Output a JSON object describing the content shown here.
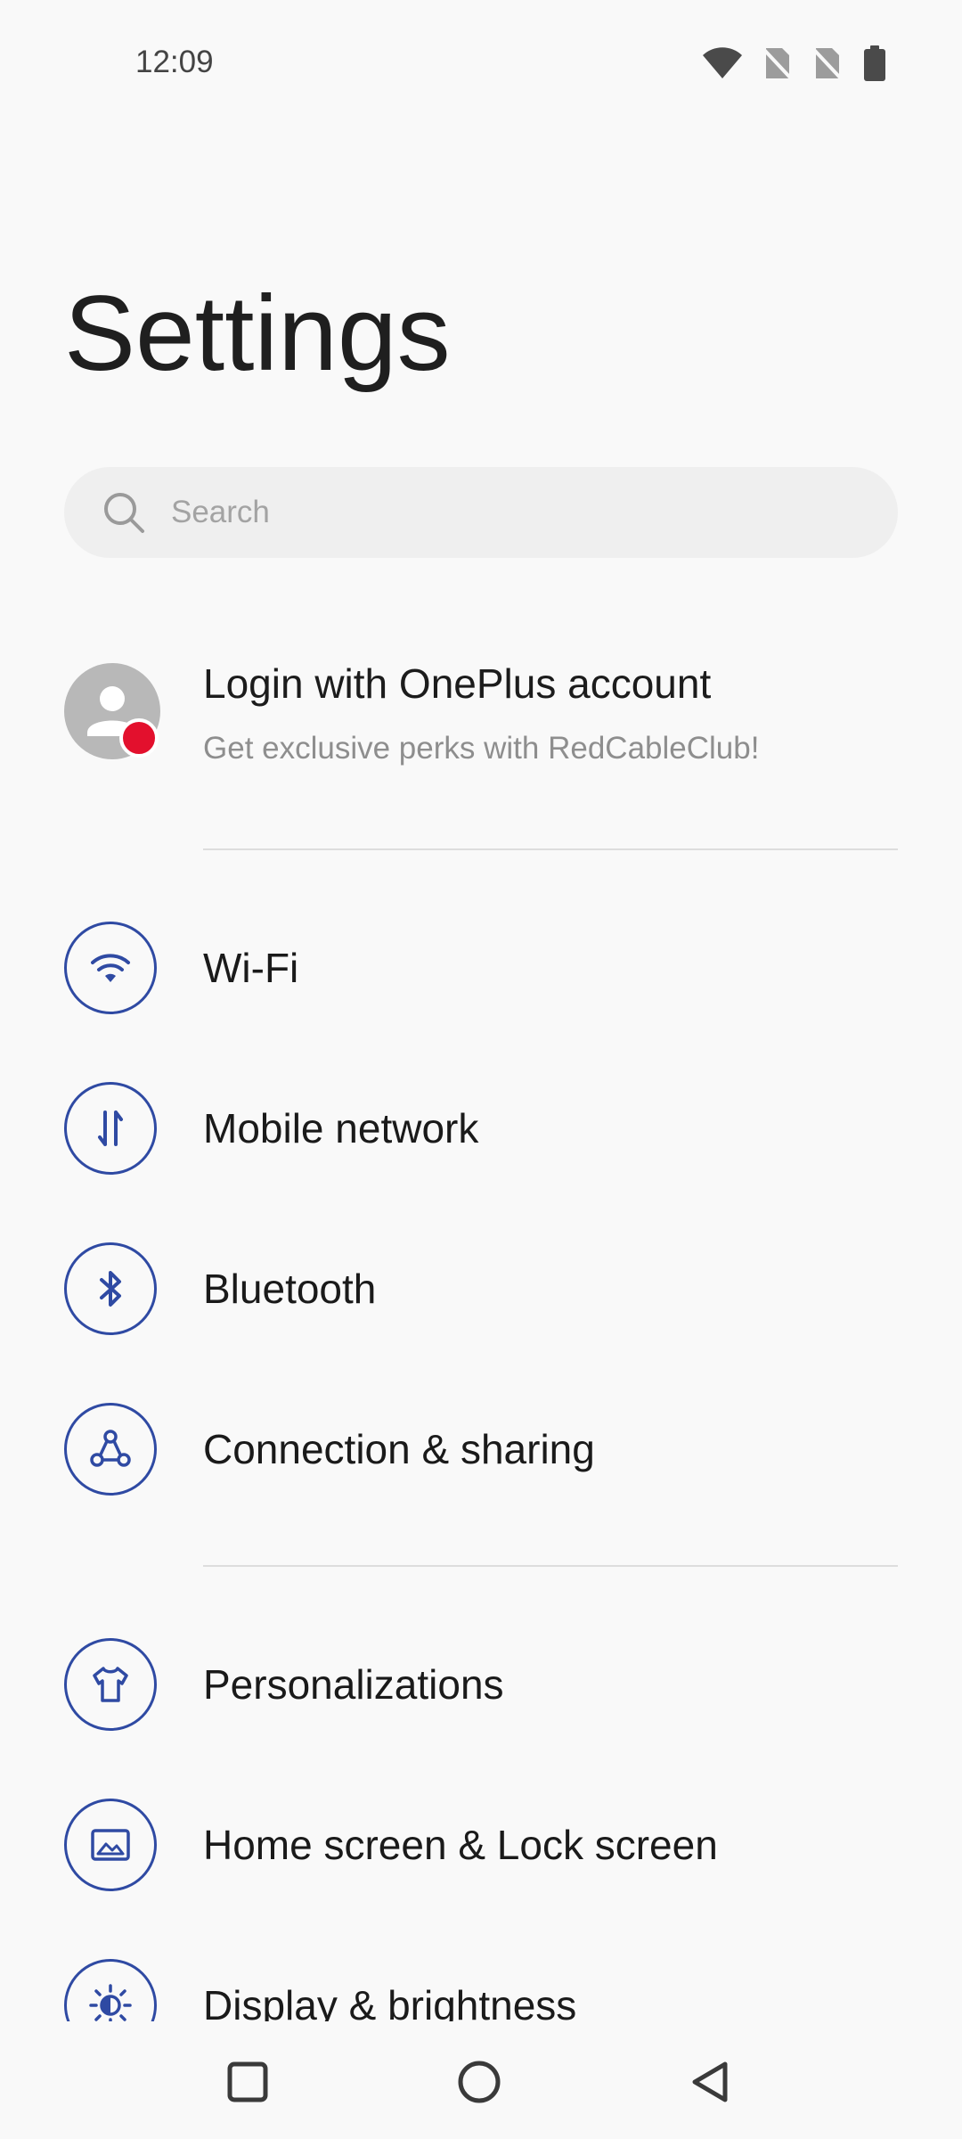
{
  "status_bar": {
    "time": "12:09",
    "icons": [
      "wifi-icon",
      "sim-none-icon",
      "sim-none-icon",
      "battery-icon"
    ]
  },
  "page": {
    "title": "Settings"
  },
  "search": {
    "placeholder": "Search",
    "icon": "search-icon"
  },
  "account": {
    "title": "Login with OnePlus account",
    "subtitle": "Get exclusive perks with RedCableClub!",
    "badge_color": "#e3102d"
  },
  "settings": {
    "group1": [
      {
        "label": "Wi-Fi",
        "icon": "wifi-icon"
      },
      {
        "label": "Mobile network",
        "icon": "data-arrows-icon"
      },
      {
        "label": "Bluetooth",
        "icon": "bluetooth-icon"
      },
      {
        "label": "Connection & sharing",
        "icon": "connection-icon"
      }
    ],
    "group2": [
      {
        "label": "Personalizations",
        "icon": "tshirt-icon"
      },
      {
        "label": "Home screen & Lock screen",
        "icon": "picture-icon"
      },
      {
        "label": "Display & brightness",
        "icon": "brightness-icon"
      }
    ]
  },
  "nav_bar": {
    "buttons": [
      "recents-button",
      "home-button",
      "back-button"
    ]
  },
  "colors": {
    "accent": "#2f4aa3",
    "background": "#f9f9f9",
    "search_bg": "#efefef"
  }
}
